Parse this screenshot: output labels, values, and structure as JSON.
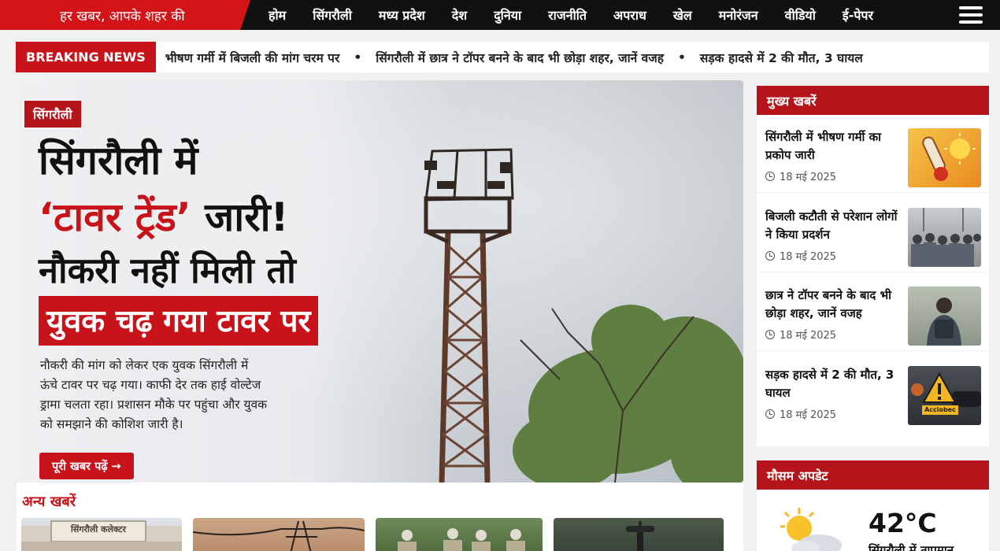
{
  "header": {
    "tagline": "हर खबर, आपके शहर की",
    "nav": [
      "होम",
      "सिंगरौली",
      "मध्य प्रदेश",
      "देश",
      "दुनिया",
      "राजनीति",
      "अपराध",
      "खेल",
      "मनोरंजन",
      "वीडियो",
      "ई-पेपर"
    ]
  },
  "ticker": {
    "label": "BREAKING NEWS",
    "items": [
      "भीषण गर्मी में बिजली की मांग चरम पर",
      "सिंगरौली में छात्र ने टॉपर बनने के बाद भी छोड़ा शहर, जानें वजह",
      "सड़क हादसे में 2 की मौत, 3 घायल"
    ]
  },
  "hero": {
    "category": "सिंगरौली",
    "line1": "सिंगरौली में",
    "line2_red": "‘टावर ट्रेंड’",
    "line2_rest": " जारी!",
    "line3": "नौकरी नहीं मिली तो",
    "band": "युवक चढ़ गया टावर पर",
    "description": "नौकरी की मांग को लेकर एक युवक सिंगरौली में ऊंचे टावर पर चढ़ गया। काफी देर तक हाई वोल्टेज ड्रामा चलता रहा। प्रशासन मौके पर पहुंचा और युवक को समझाने की कोशिश जारी है।",
    "read_more": "पूरी खबर पढ़ें →"
  },
  "other_news": {
    "title": "अन्य खबरें",
    "thumb1_sign": "सिंगरौली कलेक्टर"
  },
  "sidebar": {
    "title": "मुख्य खबरें",
    "items": [
      {
        "title": "सिंगरौली में भीषण गर्मी का प्रकोप जारी",
        "date": "18 मई 2025"
      },
      {
        "title": "बिजली कटौती से परेशान लोगों ने किया प्रदर्शन",
        "date": "18 मई 2025"
      },
      {
        "title": "छात्र ने टॉपर बनने के बाद भी छोड़ा शहर, जानें वजह",
        "date": "18 मई 2025"
      },
      {
        "title": "सड़क हादसे में 2 की मौत, 3 घायल",
        "date": "18 मई 2025"
      }
    ],
    "accident_sign": "Acciobec"
  },
  "weather": {
    "title": "मौसम अपडेट",
    "temp": "42°C",
    "city": "सिंगरौली में तापमान"
  }
}
